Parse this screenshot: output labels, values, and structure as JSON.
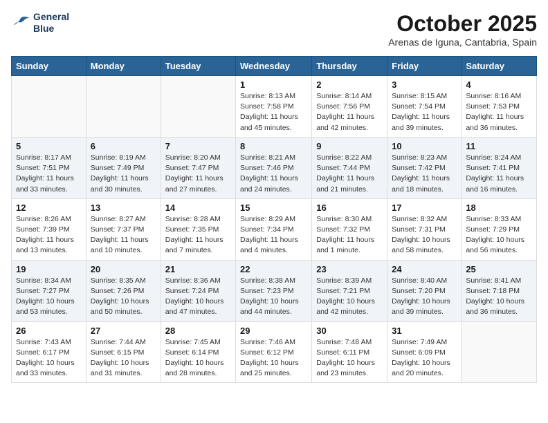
{
  "header": {
    "logo_line1": "General",
    "logo_line2": "Blue",
    "month": "October 2025",
    "location": "Arenas de Iguna, Cantabria, Spain"
  },
  "weekdays": [
    "Sunday",
    "Monday",
    "Tuesday",
    "Wednesday",
    "Thursday",
    "Friday",
    "Saturday"
  ],
  "weeks": [
    [
      {
        "day": "",
        "info": ""
      },
      {
        "day": "",
        "info": ""
      },
      {
        "day": "",
        "info": ""
      },
      {
        "day": "1",
        "info": "Sunrise: 8:13 AM\nSunset: 7:58 PM\nDaylight: 11 hours\nand 45 minutes."
      },
      {
        "day": "2",
        "info": "Sunrise: 8:14 AM\nSunset: 7:56 PM\nDaylight: 11 hours\nand 42 minutes."
      },
      {
        "day": "3",
        "info": "Sunrise: 8:15 AM\nSunset: 7:54 PM\nDaylight: 11 hours\nand 39 minutes."
      },
      {
        "day": "4",
        "info": "Sunrise: 8:16 AM\nSunset: 7:53 PM\nDaylight: 11 hours\nand 36 minutes."
      }
    ],
    [
      {
        "day": "5",
        "info": "Sunrise: 8:17 AM\nSunset: 7:51 PM\nDaylight: 11 hours\nand 33 minutes."
      },
      {
        "day": "6",
        "info": "Sunrise: 8:19 AM\nSunset: 7:49 PM\nDaylight: 11 hours\nand 30 minutes."
      },
      {
        "day": "7",
        "info": "Sunrise: 8:20 AM\nSunset: 7:47 PM\nDaylight: 11 hours\nand 27 minutes."
      },
      {
        "day": "8",
        "info": "Sunrise: 8:21 AM\nSunset: 7:46 PM\nDaylight: 11 hours\nand 24 minutes."
      },
      {
        "day": "9",
        "info": "Sunrise: 8:22 AM\nSunset: 7:44 PM\nDaylight: 11 hours\nand 21 minutes."
      },
      {
        "day": "10",
        "info": "Sunrise: 8:23 AM\nSunset: 7:42 PM\nDaylight: 11 hours\nand 18 minutes."
      },
      {
        "day": "11",
        "info": "Sunrise: 8:24 AM\nSunset: 7:41 PM\nDaylight: 11 hours\nand 16 minutes."
      }
    ],
    [
      {
        "day": "12",
        "info": "Sunrise: 8:26 AM\nSunset: 7:39 PM\nDaylight: 11 hours\nand 13 minutes."
      },
      {
        "day": "13",
        "info": "Sunrise: 8:27 AM\nSunset: 7:37 PM\nDaylight: 11 hours\nand 10 minutes."
      },
      {
        "day": "14",
        "info": "Sunrise: 8:28 AM\nSunset: 7:35 PM\nDaylight: 11 hours\nand 7 minutes."
      },
      {
        "day": "15",
        "info": "Sunrise: 8:29 AM\nSunset: 7:34 PM\nDaylight: 11 hours\nand 4 minutes."
      },
      {
        "day": "16",
        "info": "Sunrise: 8:30 AM\nSunset: 7:32 PM\nDaylight: 11 hours\nand 1 minute."
      },
      {
        "day": "17",
        "info": "Sunrise: 8:32 AM\nSunset: 7:31 PM\nDaylight: 10 hours\nand 58 minutes."
      },
      {
        "day": "18",
        "info": "Sunrise: 8:33 AM\nSunset: 7:29 PM\nDaylight: 10 hours\nand 56 minutes."
      }
    ],
    [
      {
        "day": "19",
        "info": "Sunrise: 8:34 AM\nSunset: 7:27 PM\nDaylight: 10 hours\nand 53 minutes."
      },
      {
        "day": "20",
        "info": "Sunrise: 8:35 AM\nSunset: 7:26 PM\nDaylight: 10 hours\nand 50 minutes."
      },
      {
        "day": "21",
        "info": "Sunrise: 8:36 AM\nSunset: 7:24 PM\nDaylight: 10 hours\nand 47 minutes."
      },
      {
        "day": "22",
        "info": "Sunrise: 8:38 AM\nSunset: 7:23 PM\nDaylight: 10 hours\nand 44 minutes."
      },
      {
        "day": "23",
        "info": "Sunrise: 8:39 AM\nSunset: 7:21 PM\nDaylight: 10 hours\nand 42 minutes."
      },
      {
        "day": "24",
        "info": "Sunrise: 8:40 AM\nSunset: 7:20 PM\nDaylight: 10 hours\nand 39 minutes."
      },
      {
        "day": "25",
        "info": "Sunrise: 8:41 AM\nSunset: 7:18 PM\nDaylight: 10 hours\nand 36 minutes."
      }
    ],
    [
      {
        "day": "26",
        "info": "Sunrise: 7:43 AM\nSunset: 6:17 PM\nDaylight: 10 hours\nand 33 minutes."
      },
      {
        "day": "27",
        "info": "Sunrise: 7:44 AM\nSunset: 6:15 PM\nDaylight: 10 hours\nand 31 minutes."
      },
      {
        "day": "28",
        "info": "Sunrise: 7:45 AM\nSunset: 6:14 PM\nDaylight: 10 hours\nand 28 minutes."
      },
      {
        "day": "29",
        "info": "Sunrise: 7:46 AM\nSunset: 6:12 PM\nDaylight: 10 hours\nand 25 minutes."
      },
      {
        "day": "30",
        "info": "Sunrise: 7:48 AM\nSunset: 6:11 PM\nDaylight: 10 hours\nand 23 minutes."
      },
      {
        "day": "31",
        "info": "Sunrise: 7:49 AM\nSunset: 6:09 PM\nDaylight: 10 hours\nand 20 minutes."
      },
      {
        "day": "",
        "info": ""
      }
    ]
  ]
}
